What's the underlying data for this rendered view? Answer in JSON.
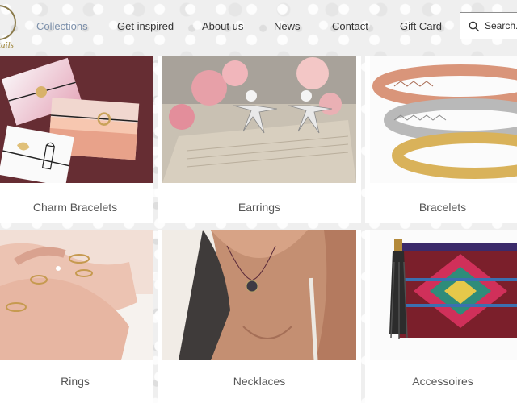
{
  "brand": {
    "logo_text": "tails"
  },
  "nav": {
    "items": [
      {
        "label": "Collections",
        "active": true
      },
      {
        "label": "Get inspired"
      },
      {
        "label": "About us"
      },
      {
        "label": "News"
      },
      {
        "label": "Contact"
      },
      {
        "label": "Gift Card"
      }
    ],
    "search_placeholder": "Search..."
  },
  "collections": [
    {
      "label": "Charm Bracelets",
      "image": "charm-bracelets-photo"
    },
    {
      "label": "Earrings",
      "image": "earrings-photo"
    },
    {
      "label": "Bracelets",
      "image": "bracelets-photo"
    },
    {
      "label": "Rings",
      "image": "rings-photo"
    },
    {
      "label": "Necklaces",
      "image": "necklaces-photo"
    },
    {
      "label": "Accessoires",
      "image": "accessoires-photo"
    }
  ],
  "colors": {
    "active_nav": "#7b8faa",
    "text": "#333333",
    "label": "#555555"
  }
}
